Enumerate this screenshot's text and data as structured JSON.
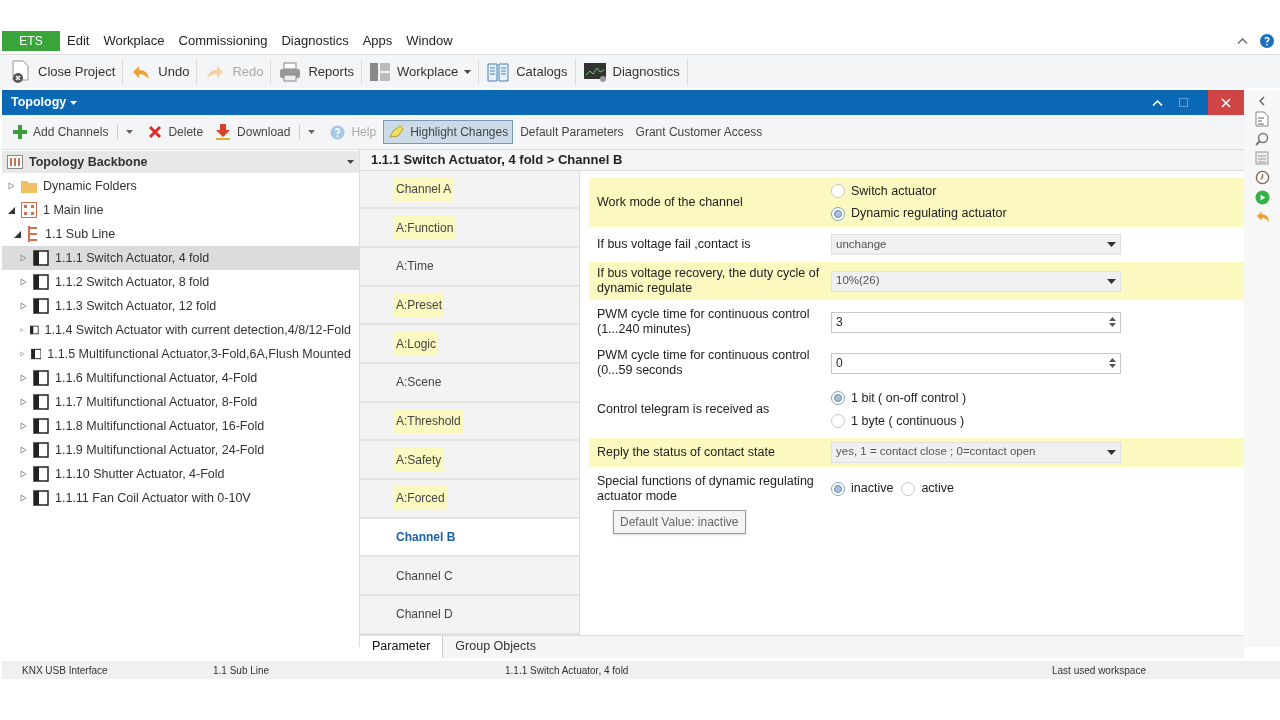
{
  "menu": {
    "app": "ETS",
    "items": [
      "Edit",
      "Workplace",
      "Commissioning",
      "Diagnostics",
      "Apps",
      "Window"
    ]
  },
  "toolbar": [
    {
      "label": "Close Project",
      "disabled": false,
      "dropdown": false
    },
    {
      "label": "Undo",
      "disabled": false,
      "dropdown": false
    },
    {
      "label": "Redo",
      "disabled": true,
      "dropdown": false
    },
    {
      "label": "Reports",
      "disabled": false,
      "dropdown": false
    },
    {
      "label": "Workplace",
      "disabled": false,
      "dropdown": true
    },
    {
      "label": "Catalogs",
      "disabled": false,
      "dropdown": false
    },
    {
      "label": "Diagnostics",
      "disabled": false,
      "dropdown": false
    }
  ],
  "panel": {
    "title": "Topology",
    "actions": [
      {
        "label": "Add Channels",
        "disabled": false,
        "dropdown": true,
        "selected": false
      },
      {
        "label": "Delete",
        "disabled": false,
        "dropdown": false,
        "selected": false
      },
      {
        "label": "Download",
        "disabled": false,
        "dropdown": true,
        "selected": false
      },
      {
        "label": "Help",
        "disabled": true,
        "dropdown": false,
        "selected": false
      },
      {
        "label": "Highlight Changes",
        "disabled": false,
        "dropdown": false,
        "selected": true
      },
      {
        "label": "Default Parameters",
        "disabled": false,
        "dropdown": false,
        "selected": false
      },
      {
        "label": "Grant Customer Access",
        "disabled": false,
        "dropdown": false,
        "selected": false
      }
    ]
  },
  "tree": {
    "title": "Topology Backbone",
    "items": [
      {
        "label": "Dynamic Folders",
        "kind": "folder",
        "expanded": false,
        "selected": false
      },
      {
        "label": "1 Main line",
        "kind": "line",
        "expanded": true,
        "selected": false,
        "children": [
          {
            "label": "1.1 Sub Line",
            "kind": "subline",
            "expanded": true,
            "selected": false,
            "children": [
              {
                "label": "1.1.1 Switch Actuator, 4 fold",
                "kind": "device",
                "expanded": false,
                "selected": true
              },
              {
                "label": "1.1.2 Switch Actuator, 8 fold",
                "kind": "device",
                "expanded": false,
                "selected": false
              },
              {
                "label": "1.1.3 Switch Actuator, 12 fold",
                "kind": "device",
                "expanded": false,
                "selected": false
              },
              {
                "label": "1.1.4 Switch Actuator with current detection,4/8/12-Fold",
                "kind": "device",
                "expanded": false,
                "selected": false
              },
              {
                "label": "1.1.5 Multifunctional Actuator,3-Fold,6A,Flush Mounted",
                "kind": "device",
                "expanded": false,
                "selected": false
              },
              {
                "label": "1.1.6 Multifunctional Actuator, 4-Fold",
                "kind": "device",
                "expanded": false,
                "selected": false
              },
              {
                "label": "1.1.7 Multifunctional Actuator, 8-Fold",
                "kind": "device",
                "expanded": false,
                "selected": false
              },
              {
                "label": "1.1.8 Multifunctional Actuator, 16-Fold",
                "kind": "device",
                "expanded": false,
                "selected": false
              },
              {
                "label": "1.1.9 Multifunctional Actuator, 24-Fold",
                "kind": "device",
                "expanded": false,
                "selected": false
              },
              {
                "label": "1.1.10 Shutter Actuator, 4-Fold",
                "kind": "device",
                "expanded": false,
                "selected": false
              },
              {
                "label": "1.1.11 Fan Coil Actuator with 0-10V",
                "kind": "device",
                "expanded": false,
                "selected": false
              }
            ]
          }
        ]
      }
    ]
  },
  "breadcrumb": "1.1.1 Switch Actuator, 4 fold > Channel B",
  "channels": [
    {
      "label": "Channel A",
      "highlighted": true,
      "selected": false
    },
    {
      "label": "A:Function",
      "highlighted": true,
      "selected": false
    },
    {
      "label": "A:Time",
      "highlighted": false,
      "selected": false
    },
    {
      "label": "A:Preset",
      "highlighted": true,
      "selected": false
    },
    {
      "label": "A:Logic",
      "highlighted": true,
      "selected": false
    },
    {
      "label": "A:Scene",
      "highlighted": false,
      "selected": false
    },
    {
      "label": "A:Threshold",
      "highlighted": true,
      "selected": false
    },
    {
      "label": "A:Safety",
      "highlighted": true,
      "selected": false
    },
    {
      "label": "A:Forced",
      "highlighted": true,
      "selected": false
    },
    {
      "label": "Channel B",
      "highlighted": false,
      "selected": true
    },
    {
      "label": "Channel C",
      "highlighted": false,
      "selected": false
    },
    {
      "label": "Channel D",
      "highlighted": false,
      "selected": false
    }
  ],
  "parameters": [
    {
      "kind": "radio",
      "label": "Work mode of the channel",
      "highlighted": true,
      "options": [
        {
          "label": "Switch actuator",
          "selected": false
        },
        {
          "label": "Dynamic regulating actuator",
          "selected": true
        }
      ]
    },
    {
      "kind": "select",
      "label": "If bus voltage fail ,contact is",
      "highlighted": false,
      "value": "unchange"
    },
    {
      "kind": "select",
      "label": "If bus voltage recovery, the duty cycle of dynamic regulate",
      "highlighted": true,
      "value": "10%(26)"
    },
    {
      "kind": "spin",
      "label": "PWM cycle time for continuous control (1...240 minutes)",
      "highlighted": false,
      "value": "3"
    },
    {
      "kind": "spin",
      "label": "PWM cycle time for continuous control (0...59 seconds",
      "highlighted": false,
      "value": "0"
    },
    {
      "kind": "radio",
      "label": "Control telegram is received as",
      "highlighted": false,
      "options": [
        {
          "label": "1 bit ( on-off control )",
          "selected": true
        },
        {
          "label": "1 byte ( continuous )",
          "selected": false
        }
      ]
    },
    {
      "kind": "select",
      "label": "Reply the status of contact state",
      "highlighted": true,
      "value": "yes, 1 = contact close ; 0=contact open"
    },
    {
      "kind": "inlineradio",
      "label": "Special functions of dynamic regulating actuator mode",
      "highlighted": false,
      "options": [
        {
          "label": "inactive",
          "selected": true
        },
        {
          "label": "active",
          "selected": false
        }
      ],
      "tooltip": "Default Value: inactive"
    }
  ],
  "bottom_tabs": [
    {
      "label": "Parameter",
      "selected": true
    },
    {
      "label": "Group Objects",
      "selected": false
    }
  ],
  "status_bar": [
    "KNX USB Interface",
    "1.1 Sub Line",
    "1.1.1 Switch Actuator, 4 fold",
    "Last used workspace"
  ]
}
